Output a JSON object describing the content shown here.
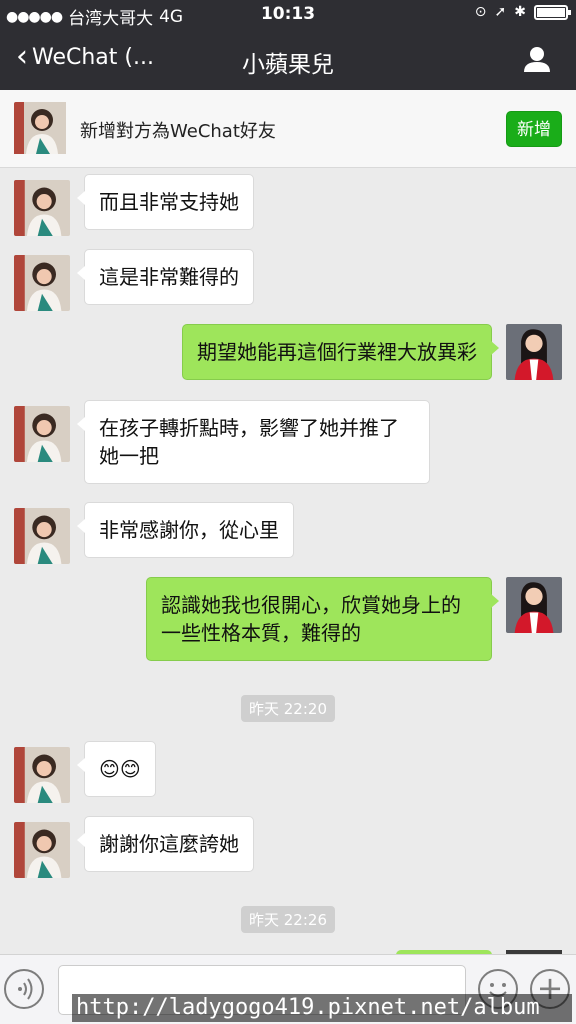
{
  "status": {
    "carrier": "台湾大哥大",
    "network": "4G",
    "time": "10:13"
  },
  "nav": {
    "back_label": "WeChat (...",
    "title": "小蘋果兒"
  },
  "add_banner": {
    "text": "新增對方為WeChat好友",
    "button": "新增"
  },
  "messages": [
    {
      "side": "left",
      "text": "而且非常支持她"
    },
    {
      "side": "left",
      "text": "這是非常難得的"
    },
    {
      "side": "right",
      "text": "期望她能再這個行業裡大放異彩"
    },
    {
      "side": "left",
      "text": "在孩子轉折點時，影響了她并推了她一把"
    },
    {
      "side": "left",
      "text": "非常感謝你，從心里"
    },
    {
      "side": "right",
      "text": "認識她我也很開心，欣賞她身上的一些性格本質，難得的"
    },
    {
      "side": "left",
      "text": "😊😊"
    },
    {
      "side": "left",
      "text": "謝謝你這麼誇她"
    }
  ],
  "timestamps": [
    "昨天 22:20",
    "昨天 22:26"
  ],
  "watermark": "http://ladygogo419.pixnet.net/album",
  "colors": {
    "header": "#2e2e33",
    "sent_bubble": "#9ee55b",
    "add_button": "#1aad19"
  }
}
